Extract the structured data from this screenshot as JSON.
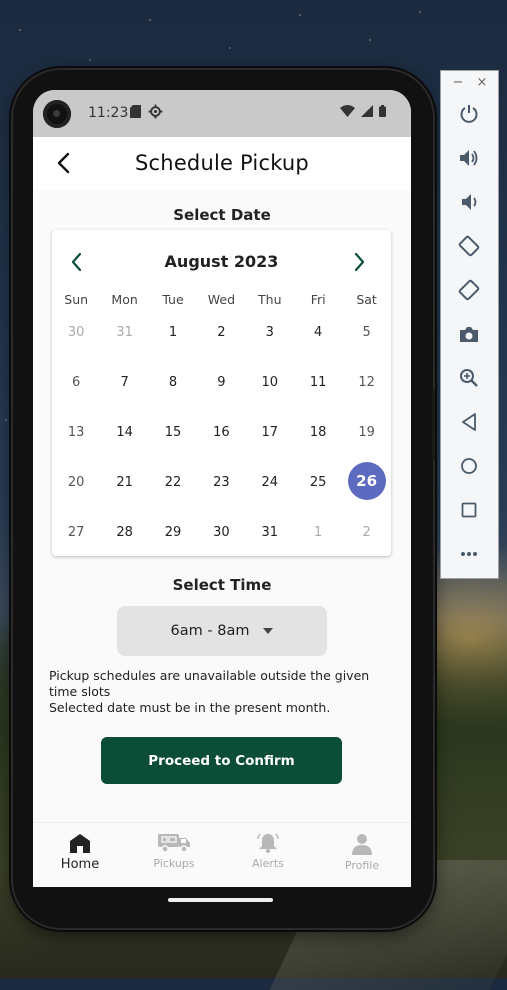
{
  "status_bar": {
    "time": "11:23"
  },
  "app_bar": {
    "title": "Schedule Pickup"
  },
  "date_section": {
    "title": "Select Date"
  },
  "calendar": {
    "month_label": "August 2023",
    "weekdays": [
      "Sun",
      "Mon",
      "Tue",
      "Wed",
      "Thu",
      "Fri",
      "Sat"
    ],
    "weeks": [
      [
        "30",
        "31",
        "1",
        "2",
        "3",
        "4",
        "5"
      ],
      [
        "6",
        "7",
        "8",
        "9",
        "10",
        "11",
        "12"
      ],
      [
        "13",
        "14",
        "15",
        "16",
        "17",
        "18",
        "19"
      ],
      [
        "20",
        "21",
        "22",
        "23",
        "24",
        "25",
        "26"
      ],
      [
        "27",
        "28",
        "29",
        "30",
        "31",
        "1",
        "2"
      ]
    ],
    "selected_day": "26",
    "accent_color": "#5c6bc0",
    "nav_color": "#0b4d36"
  },
  "time_section": {
    "title": "Select Time",
    "selected_slot": "6am - 8am"
  },
  "info": {
    "line1": "Pickup schedules are unavailable outside the given time slots",
    "line2": "Selected date must be in the present month."
  },
  "confirm_button": {
    "label": "Proceed to Confirm",
    "color": "#0b4d36"
  },
  "bottom_nav": {
    "items": [
      {
        "label": "Home",
        "icon": "home-icon",
        "active": true
      },
      {
        "label": "Pickups",
        "icon": "truck-icon",
        "active": false
      },
      {
        "label": "Alerts",
        "icon": "bell-icon",
        "active": false
      },
      {
        "label": "Profile",
        "icon": "person-icon",
        "active": false
      }
    ]
  },
  "emulator_toolbar": {
    "window_controls": [
      "−",
      "×"
    ],
    "buttons": [
      "power-icon",
      "volume-up-icon",
      "volume-down-icon",
      "rotate-left-icon",
      "rotate-right-icon",
      "camera-icon",
      "zoom-icon",
      "back-icon",
      "home-circle-icon",
      "overview-icon",
      "more-icon"
    ]
  }
}
